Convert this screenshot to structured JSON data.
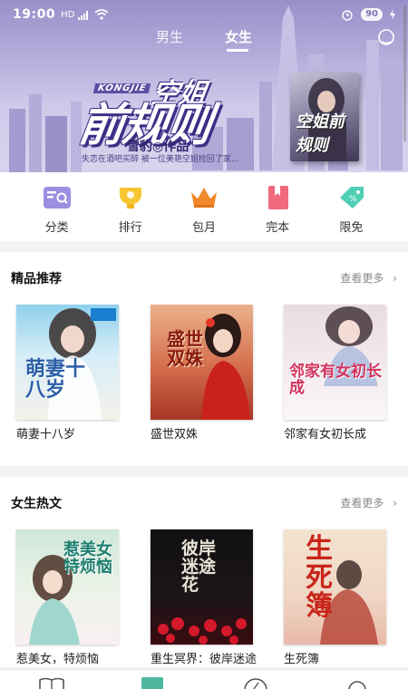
{
  "status_bar": {
    "time": "19:00",
    "network": "HD",
    "battery": "90"
  },
  "tabs": [
    {
      "label": "男生",
      "selected": false
    },
    {
      "label": "女生",
      "selected": true
    }
  ],
  "banner": {
    "title_top": "空姐",
    "title_main": "前规则",
    "title_pinyin": "KONGJIE",
    "author": "雪豹◎作品",
    "tagline": "失恋在酒吧买醉  被一位美艳空姐捡回了家…",
    "book_title": "空姐前规则"
  },
  "quick_nav": [
    {
      "label": "分类",
      "icon": "category-icon"
    },
    {
      "label": "排行",
      "icon": "ranking-trophy-icon"
    },
    {
      "label": "包月",
      "icon": "monthly-crown-icon"
    },
    {
      "label": "完本",
      "icon": "finished-bookmark-icon"
    },
    {
      "label": "限免",
      "icon": "free-tag-icon"
    }
  ],
  "featured": {
    "title": "精品推荐",
    "more": "查看更多",
    "books": [
      {
        "title": "萌妻十八岁",
        "cover_text": "萌妻十八岁"
      },
      {
        "title": "盛世双姝",
        "cover_text": "盛世双姝"
      },
      {
        "title": "邻家有女初长成",
        "cover_text": "邻家有女初长成"
      }
    ]
  },
  "hot": {
    "title": "女生热文",
    "more": "查看更多",
    "books": [
      {
        "title": "惹美女，特烦恼",
        "cover_text": "惹美女特烦恼"
      },
      {
        "title": "重生冥界：彼岸迷途花",
        "cover_text": "彼岸迷途花"
      },
      {
        "title": "生死簿",
        "cover_text": "生死簿"
      }
    ]
  },
  "colors": {
    "accent": "#4db89c",
    "banner_purple": "#3b2f86"
  }
}
